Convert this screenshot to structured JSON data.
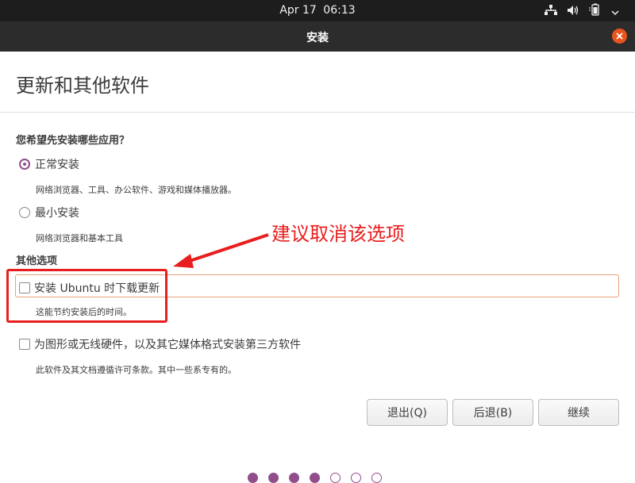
{
  "topbar": {
    "date": "Apr 17",
    "time": "06:13"
  },
  "window": {
    "title": "安装"
  },
  "page": {
    "title": "更新和其他软件",
    "question": "您希望先安装哪些应用？"
  },
  "install_options": [
    {
      "label": "正常安装",
      "description": "网络浏览器、工具、办公软件、游戏和媒体播放器。",
      "selected": true
    },
    {
      "label": "最小安装",
      "description": "网络浏览器和基本工具",
      "selected": false
    }
  ],
  "other": {
    "heading": "其他选项",
    "download_updates": {
      "label": "安装 Ubuntu 时下载更新",
      "description": "这能节约安装后的时间。",
      "checked": false
    },
    "third_party": {
      "label": "为图形或无线硬件，以及其它媒体格式安装第三方软件",
      "description": "此软件及其文档遵循许可条款。其中一些系专有的。",
      "checked": false
    }
  },
  "annotation": {
    "text": "建议取消该选项",
    "color": "#e81e1e"
  },
  "buttons": {
    "quit": "退出(Q)",
    "back": "后退(B)",
    "continue": "继续"
  },
  "progress": {
    "steps_total": 7,
    "steps_done": 4
  },
  "colors": {
    "accent": "#924d8b",
    "close": "#e9541e",
    "focus": "#e8a07a"
  }
}
